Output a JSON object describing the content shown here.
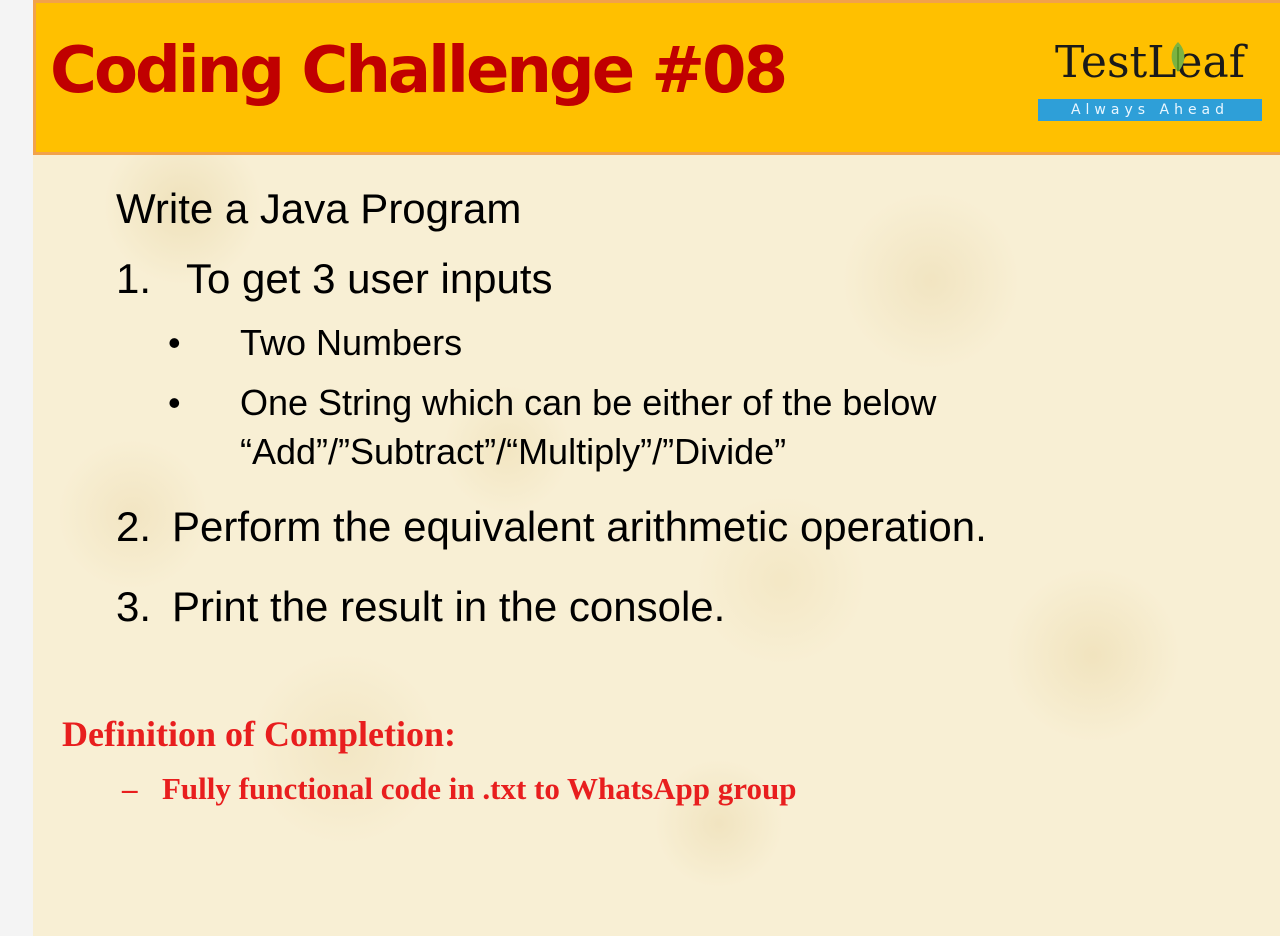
{
  "header": {
    "title": "Coding Challenge #08",
    "logo": {
      "name": "TestLeaf",
      "tagline": "Always Ahead",
      "icon": "leaf-icon"
    }
  },
  "content": {
    "intro": "Write a Java Program",
    "items": [
      {
        "marker": "1.",
        "text": "To get 3 user inputs"
      },
      {
        "marker": "2.",
        "text": "Perform the equivalent arithmetic operation."
      },
      {
        "marker": "3.",
        "text": "Print the result in the console."
      }
    ],
    "sub_items": [
      {
        "marker": "•",
        "text": "Two Numbers"
      },
      {
        "marker": "•",
        "text": "One String which can be either of the below",
        "continuation": "“Add”/”Subtract”/“Multiply”/”Divide”"
      }
    ]
  },
  "completion": {
    "title": "Definition of Completion:",
    "items": [
      {
        "marker": "–",
        "text": "Fully functional code in .txt to WhatsApp group"
      }
    ]
  },
  "colors": {
    "header_bg": "#ffc000",
    "title": "#c00000",
    "completion": "#e81e1e",
    "logo_banner": "#2e9fd8",
    "page_bg": "#f8efd4"
  }
}
